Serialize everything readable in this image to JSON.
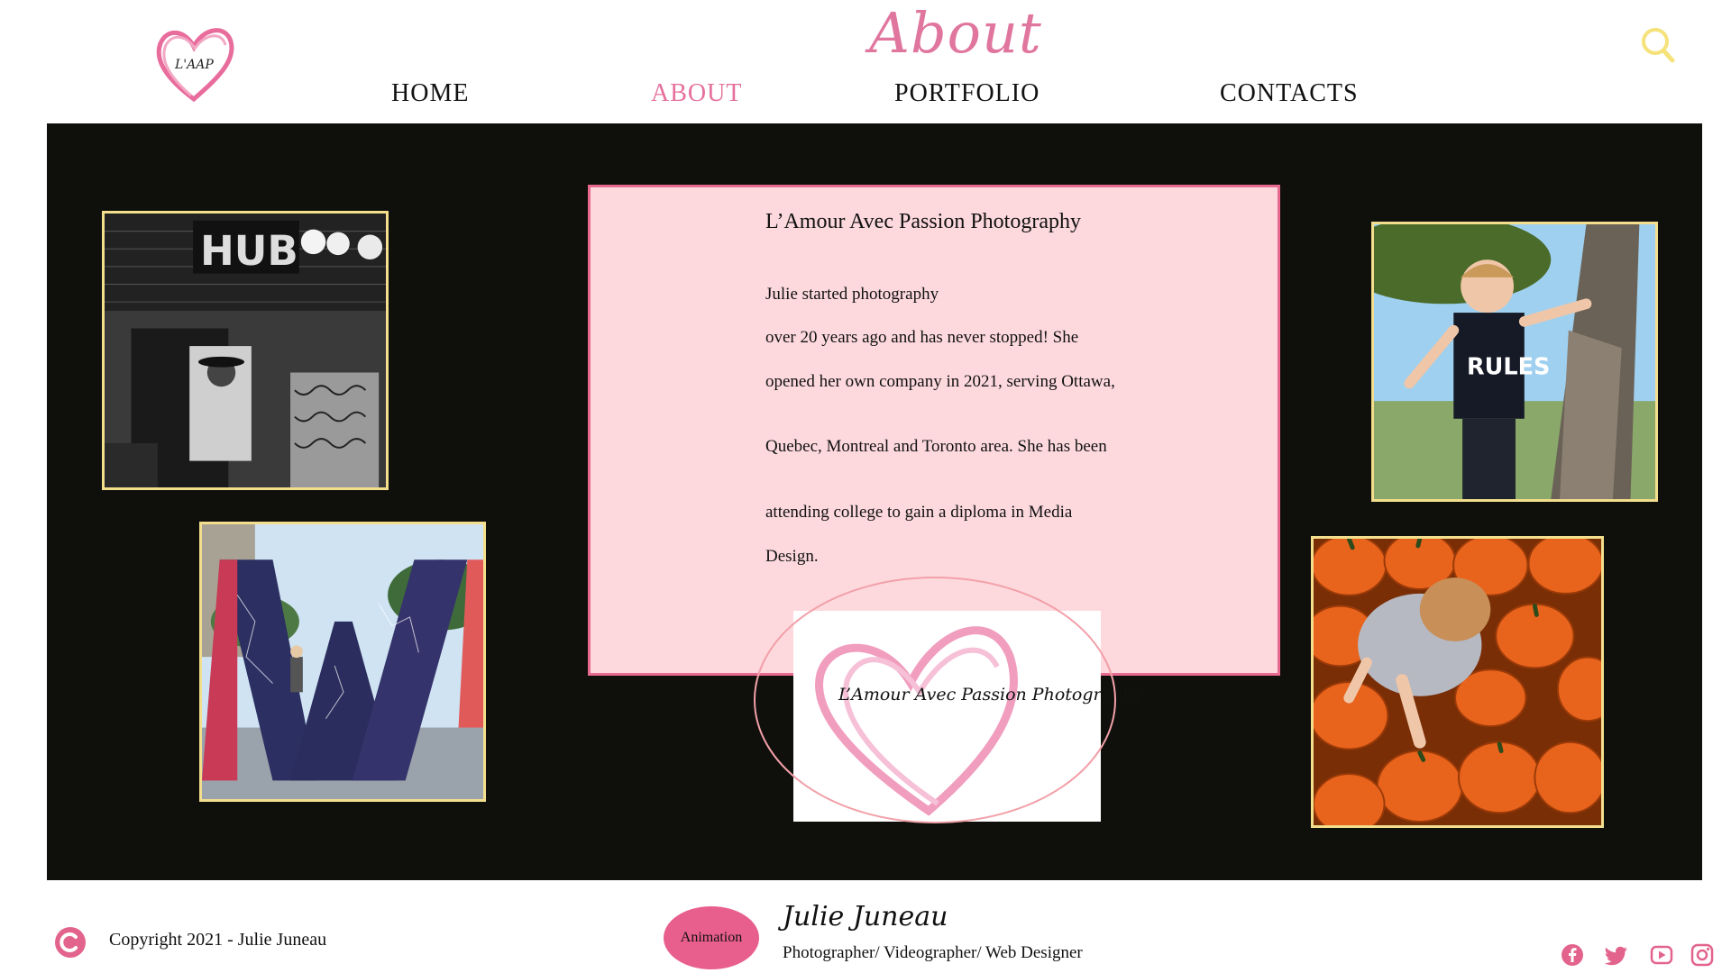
{
  "header": {
    "logo_text": "L'AAP",
    "page_title": "About",
    "nav": [
      {
        "label": "HOME",
        "active": false
      },
      {
        "label": "ABOUT",
        "active": true
      },
      {
        "label": "PORTFOLIO",
        "active": false
      },
      {
        "label": "CONTACTS",
        "active": false
      }
    ],
    "search_icon": "search-icon"
  },
  "about": {
    "title": "L’Amour Avec Passion Photography",
    "paragraphs": [
      "Julie started photography",
      " over 20 years ago and has never stopped! She",
      "opened her own company in 2021, serving Ottawa,",
      "Quebec, Montreal and Toronto area. She has been",
      "attending college to gain a diploma in Media",
      "Design."
    ],
    "brand_image_caption": "L’Amour Avec Passion Photography"
  },
  "gallery": {
    "photo_1_sign": "HUB",
    "photo_3_shirt": "RULES"
  },
  "footer": {
    "copyright": "Copyright 2021 - Julie Juneau",
    "animation_button": "Animation",
    "signature": "Julie Juneau",
    "role": "Photographer/ Videographer/ Web Designer",
    "social_icons": [
      "facebook-icon",
      "twitter-icon",
      "youtube-icon",
      "instagram-icon"
    ]
  },
  "colors": {
    "accent_pink": "#e5709c",
    "card_bg": "#fdd9de",
    "panel_bg": "#0f0f0c",
    "frame_gold": "#f2de8c",
    "search_yellow": "#f5e27a"
  }
}
